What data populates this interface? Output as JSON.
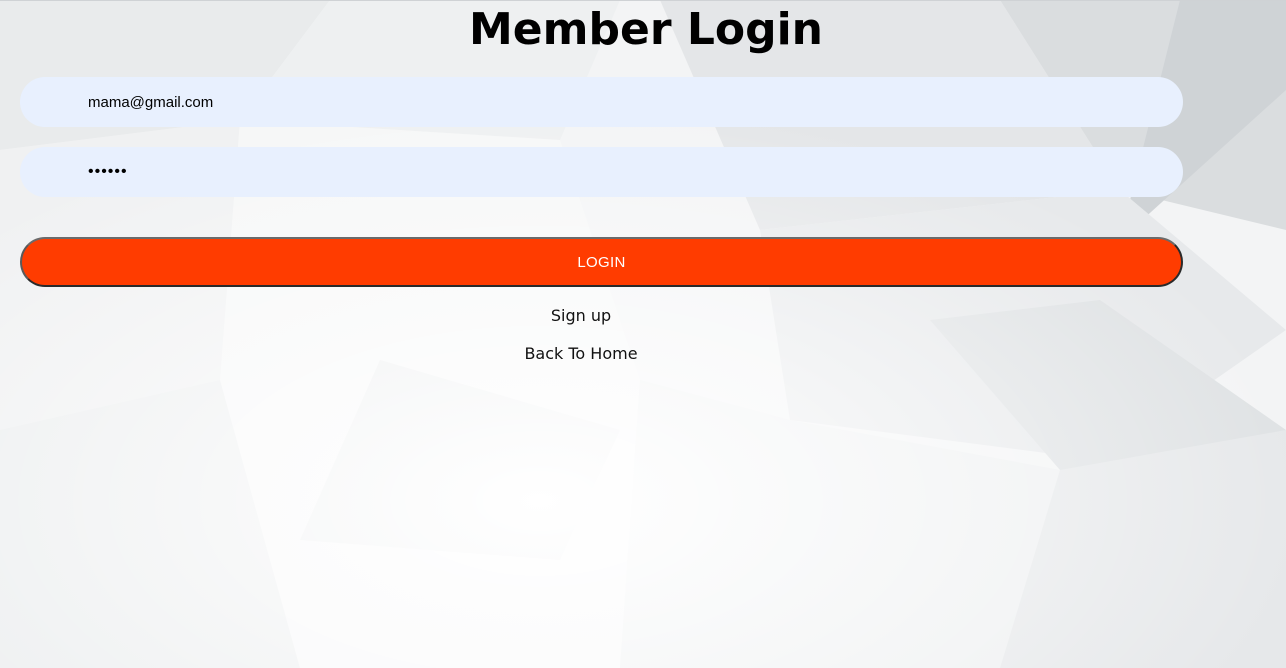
{
  "page": {
    "title": "Member Login"
  },
  "form": {
    "email_value": "mama@gmail.com",
    "password_value": "secret",
    "login_label": "LOGIN"
  },
  "links": {
    "signup": "Sign up",
    "home": "Back To Home"
  },
  "colors": {
    "accent": "#ff3c00",
    "input_bg": "#e8f0fe",
    "text": "#000000"
  }
}
